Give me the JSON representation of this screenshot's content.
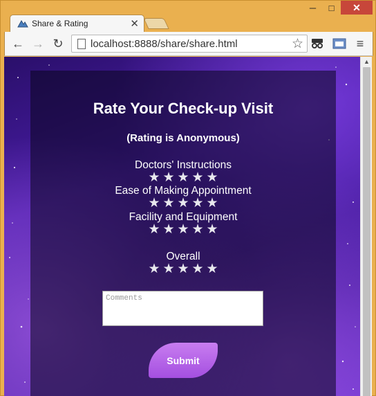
{
  "window": {
    "minimize_glyph": "─",
    "maximize_glyph": "□",
    "close_glyph": "✕"
  },
  "tab": {
    "title": "Share & Rating",
    "close_glyph": "✕"
  },
  "toolbar": {
    "back_glyph": "←",
    "forward_glyph": "→",
    "reload_glyph": "↻",
    "url": "localhost:8888/share/share.html",
    "bookmark_glyph": "☆",
    "menu_glyph": "≡"
  },
  "page": {
    "title": "Rate Your Check-up Visit",
    "subtitle": "(Rating is Anonymous)",
    "ratings": [
      {
        "label": "Doctors' Instructions",
        "stars": 5
      },
      {
        "label": "Ease of Making Appointment",
        "stars": 5
      },
      {
        "label": "Facility and Equipment",
        "stars": 5
      },
      {
        "label": "Overall",
        "stars": 5
      }
    ],
    "comments_placeholder": "Comments",
    "submit_label": "Submit",
    "star_glyph": "★",
    "star_color": "#e8e8ee"
  },
  "colors": {
    "frame": "#eab04f",
    "close_button": "#c7463a",
    "submit_top": "#c87df0",
    "submit_bottom": "#a44fe0"
  }
}
